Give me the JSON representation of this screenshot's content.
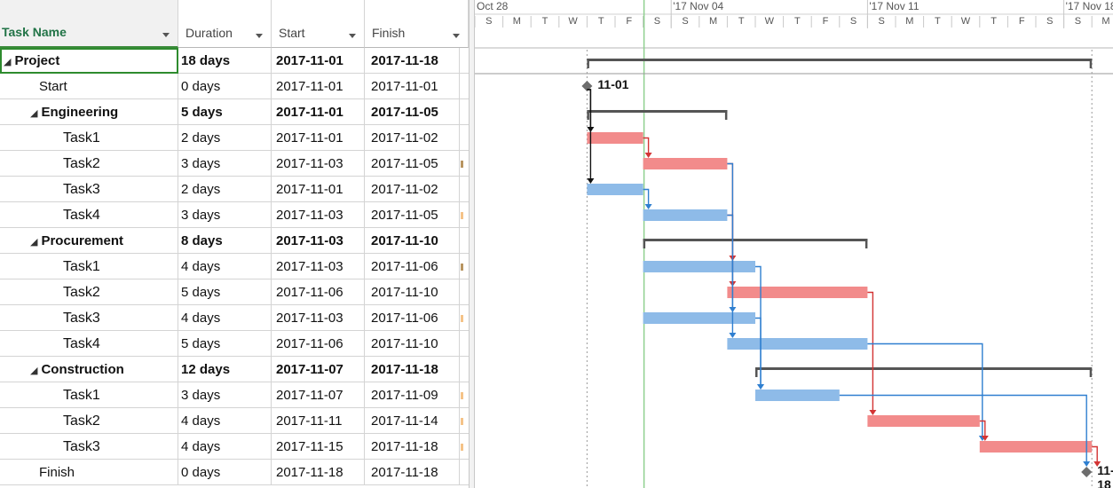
{
  "columns": {
    "task_name": "Task Name",
    "duration": "Duration",
    "start": "Start",
    "finish": "Finish"
  },
  "timeline": {
    "weeks": [
      "Oct 28",
      "'17 Nov 04",
      "'17 Nov 11",
      "'17 Nov 18"
    ],
    "days": [
      "S",
      "M",
      "T",
      "W",
      "T",
      "F",
      "S",
      "S",
      "M",
      "T",
      "W",
      "T",
      "F",
      "S",
      "S",
      "M",
      "T",
      "W",
      "T",
      "F",
      "S",
      "S",
      "M"
    ]
  },
  "tasks": [
    {
      "name": "Project",
      "duration": "18 days",
      "start": "2017-11-01",
      "finish": "2017-11-18",
      "type": "summary",
      "level": 0
    },
    {
      "name": "Start",
      "duration": "0 days",
      "start": "2017-11-01",
      "finish": "2017-11-01",
      "type": "milestone",
      "level": 1
    },
    {
      "name": "Engineering",
      "duration": "5 days",
      "start": "2017-11-01",
      "finish": "2017-11-05",
      "type": "summary",
      "level": 1
    },
    {
      "name": "Task1",
      "duration": "2 days",
      "start": "2017-11-01",
      "finish": "2017-11-02",
      "type": "critical",
      "level": 2
    },
    {
      "name": "Task2",
      "duration": "3 days",
      "start": "2017-11-03",
      "finish": "2017-11-05",
      "type": "critical",
      "level": 2
    },
    {
      "name": "Task3",
      "duration": "2 days",
      "start": "2017-11-01",
      "finish": "2017-11-02",
      "type": "normal",
      "level": 2
    },
    {
      "name": "Task4",
      "duration": "3 days",
      "start": "2017-11-03",
      "finish": "2017-11-05",
      "type": "normal",
      "level": 2
    },
    {
      "name": "Procurement",
      "duration": "8 days",
      "start": "2017-11-03",
      "finish": "2017-11-10",
      "type": "summary",
      "level": 1
    },
    {
      "name": "Task1",
      "duration": "4 days",
      "start": "2017-11-03",
      "finish": "2017-11-06",
      "type": "normal",
      "level": 2
    },
    {
      "name": "Task2",
      "duration": "5 days",
      "start": "2017-11-06",
      "finish": "2017-11-10",
      "type": "critical",
      "level": 2
    },
    {
      "name": "Task3",
      "duration": "4 days",
      "start": "2017-11-03",
      "finish": "2017-11-06",
      "type": "normal",
      "level": 2
    },
    {
      "name": "Task4",
      "duration": "5 days",
      "start": "2017-11-06",
      "finish": "2017-11-10",
      "type": "normal",
      "level": 2
    },
    {
      "name": "Construction",
      "duration": "12 days",
      "start": "2017-11-07",
      "finish": "2017-11-18",
      "type": "summary",
      "level": 1
    },
    {
      "name": "Task1",
      "duration": "3 days",
      "start": "2017-11-07",
      "finish": "2017-11-09",
      "type": "normal",
      "level": 2
    },
    {
      "name": "Task2",
      "duration": "4 days",
      "start": "2017-11-11",
      "finish": "2017-11-14",
      "type": "critical",
      "level": 2
    },
    {
      "name": "Task3",
      "duration": "4 days",
      "start": "2017-11-15",
      "finish": "2017-11-18",
      "type": "critical",
      "level": 2
    },
    {
      "name": "Finish",
      "duration": "0 days",
      "start": "2017-11-18",
      "finish": "2017-11-18",
      "type": "milestone",
      "level": 1
    }
  ],
  "milestone_labels": {
    "start": "11-01",
    "finish": "11-18"
  },
  "colors": {
    "critical_bar": "#f28b8b",
    "normal_bar": "#8ebbe8",
    "summary_bar": "#555555",
    "critical_link": "#d33434",
    "normal_link": "#2f7fd0",
    "default_link": "#111111",
    "today_line": "#8fd08f",
    "header_green": "#217346"
  },
  "icons": {
    "collapse": "collapse-triangle-icon",
    "dropdown": "dropdown-arrow-icon",
    "milestone": "diamond-icon"
  }
}
